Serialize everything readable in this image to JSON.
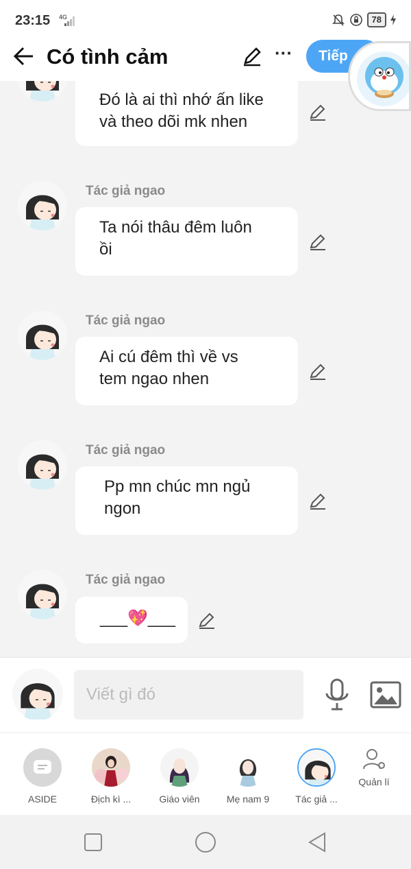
{
  "status": {
    "time": "23:15",
    "network": "4G",
    "battery": "78"
  },
  "header": {
    "title": "Có tình cảm",
    "next_label": "Tiếp"
  },
  "messages": [
    {
      "sender": "",
      "text": "Đó là ai thì nhớ ấn like\nvà theo dõi mk nhen"
    },
    {
      "sender": "Tác giả ngao",
      "text": "Ta nói thâu đêm luôn\nồi"
    },
    {
      "sender": "Tác giả ngao",
      "text": "Ai cú đêm thì về vs\ntem ngao nhen"
    },
    {
      "sender": "Tác giả ngao",
      "text": "Pp mn chúc mn ngủ\nngon"
    },
    {
      "sender": "Tác giả ngao",
      "text": "___💖___"
    }
  ],
  "input": {
    "placeholder": "Viết gì đó"
  },
  "characters": [
    {
      "label": "ASIDE"
    },
    {
      "label": "Địch kì ..."
    },
    {
      "label": "Giáo viên"
    },
    {
      "label": "Mẹ nam 9"
    },
    {
      "label": "Tác giả ..."
    }
  ],
  "manage_label": "Quản lí",
  "icons": {
    "back": "arrow-left-icon",
    "edit": "pencil-icon",
    "more": "more-dots-icon",
    "mic": "microphone-icon",
    "image": "image-icon",
    "aside": "chat-bubble-icon",
    "manage": "user-gear-icon",
    "nav_square": "recent-apps-icon",
    "nav_circle": "home-icon",
    "nav_triangle": "back-nav-icon"
  },
  "colors": {
    "accent": "#4da6f5",
    "bubble": "#ffffff",
    "background": "#f3f3f3"
  }
}
